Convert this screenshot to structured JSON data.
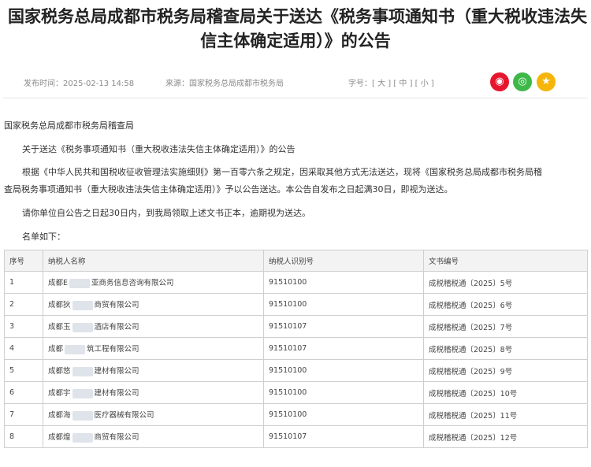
{
  "title": {
    "line1": "国家税务总局成都市税务局稽查局关于送达《税务事项通知书（重大税收违法失",
    "line2": "信主体确定适用）》的公告"
  },
  "meta": {
    "publish_label": "发布时间：2025-02-13 14:58",
    "source_label": "来源：国家税务总局成都市税务局",
    "font_label": "字号：[ 大 ] [ 中 ] [ 小 ]"
  },
  "share": [
    {
      "icon": "weibo-icon",
      "color": "#e6162d",
      "glyph": "◉"
    },
    {
      "icon": "wechat-icon",
      "color": "#3fb84a",
      "glyph": "◎"
    },
    {
      "icon": "qzone-icon",
      "color": "#f5b50a",
      "glyph": "★"
    }
  ],
  "body": {
    "org": "国家税务总局成都市税务局稽查局",
    "subject": "关于送达《税务事项通知书（重大税收违法失信主体确定适用）》的公告",
    "para1_line1": "根据《中华人民共和国税收征收管理法实施细则》第一百零六条之规定，因采取其他方式无法送达，现将《国家税务总局成都市税务局稽",
    "para1_line2": "查局税务事项通知书（重大税收违法失信主体确定适用）》予以公告送达。本公告自发布之日起满30日，即视为送达。",
    "para2": "请你单位自公告之日起30日内，到我局领取上述文书正本，逾期视为送达。",
    "list_intro": "名单如下："
  },
  "table": {
    "headers": [
      "序号",
      "纳税人名称",
      "纳税人识别号",
      "文书编号"
    ],
    "rows": [
      {
        "no": "1",
        "name_a": "成都E",
        "name_b": "亚商务信息咨询有限公司",
        "tin": "91510100",
        "doc": "成税稽税通〔2025〕5号"
      },
      {
        "no": "2",
        "name_a": "成都狄",
        "name_b": "商贸有限公司",
        "tin": "91510100",
        "doc": "成税稽税通〔2025〕6号"
      },
      {
        "no": "3",
        "name_a": "成都玉",
        "name_b": "酒店有限公司",
        "tin": "91510107",
        "doc": "成税稽税通〔2025〕7号"
      },
      {
        "no": "4",
        "name_a": "成都",
        "name_b": "筑工程有限公司",
        "tin": "91510107",
        "doc": "成税稽税通〔2025〕8号"
      },
      {
        "no": "5",
        "name_a": "成都悠",
        "name_b": "建材有限公司",
        "tin": "91510100",
        "doc": "成税稽税通〔2025〕9号"
      },
      {
        "no": "6",
        "name_a": "成都宇",
        "name_b": "建材有限公司",
        "tin": "91510100",
        "doc": "成税稽税通〔2025〕10号"
      },
      {
        "no": "7",
        "name_a": "成都海",
        "name_b": "医疗器械有限公司",
        "tin": "91510100",
        "doc": "成税稽税通〔2025〕11号"
      },
      {
        "no": "8",
        "name_a": "成都煌",
        "name_b": "商贸有限公司",
        "tin": "91510107",
        "doc": "成税稽税通〔2025〕12号"
      }
    ]
  }
}
